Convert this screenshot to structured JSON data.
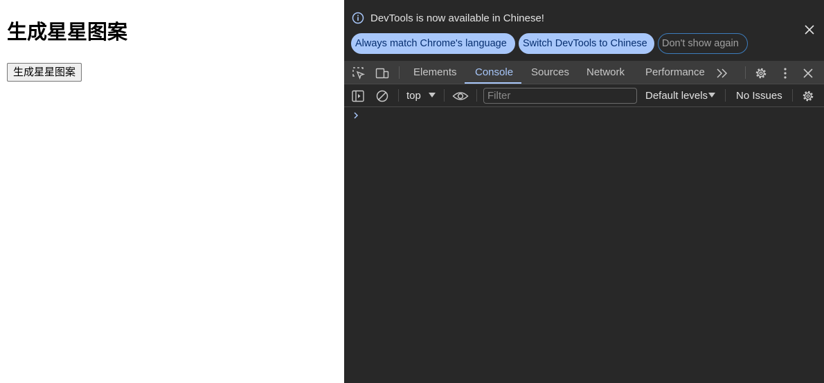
{
  "page": {
    "heading": "生成星星图案",
    "button_label": "生成星星图案"
  },
  "devtools": {
    "infobar": {
      "message": "DevTools is now available in Chinese!",
      "buttons": [
        {
          "label": "Always match Chrome's language"
        },
        {
          "label": "Switch DevTools to Chinese"
        },
        {
          "label": "Don't show again"
        }
      ]
    },
    "tabs": [
      {
        "label": "Elements",
        "active": false
      },
      {
        "label": "Console",
        "active": true
      },
      {
        "label": "Sources",
        "active": false
      },
      {
        "label": "Network",
        "active": false
      },
      {
        "label": "Performance",
        "active": false
      }
    ],
    "console_toolbar": {
      "context": "top",
      "filter_placeholder": "Filter",
      "levels": "Default levels",
      "issues": "No Issues"
    }
  },
  "colors": {
    "devtools_bg": "#282828",
    "toolbar_bg": "#3c3c3c",
    "accent": "#a8c7fa",
    "accent_text": "#062e6f"
  }
}
